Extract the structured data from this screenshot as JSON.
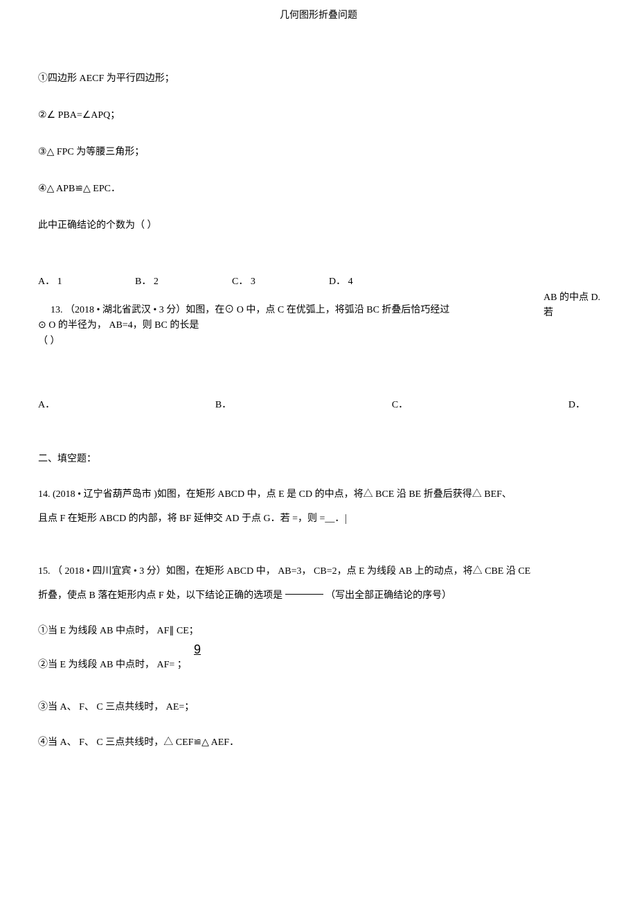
{
  "header": {
    "title": "几何图形折叠问题"
  },
  "body": {
    "p1": "①四边形   AECF 为平行四边形；",
    "p2": "②∠ PBA=∠APQ；",
    "p3": "③△ FPC 为等腰三角形；",
    "p4": "④△ APB≌△ EPC．",
    "p5": "此中正确结论的个数为（             ）",
    "options12": {
      "a": "A． 1",
      "b": "B． 2",
      "c": "C． 3",
      "d": "D． 4"
    },
    "q13": {
      "line1_main": "13. （2018 •  湖北省武汉   • 3 分）如图，在⊙  O 中，点  C 在优弧上，将弧沿      BC 折叠后恰巧经过",
      "line1_right_a": "AB 的中点  D.",
      "line1_right_b": "若",
      "line2": "⊙ O 的半径为，  AB=4，则 BC 的长是",
      "line3": "（                                                          ）",
      "opts": {
        "a": "A．",
        "b": "B．",
        "c": "C．",
        "d": "D．"
      }
    },
    "section2": {
      "heading": "二、填空题："
    },
    "q14": {
      "line1": "14. (2018  • 辽宁省葫芦岛市  )如图，在矩形   ABCD 中，点  E 是  CD 的中点，将△   BCE 沿 BE 折叠后获得△    BEF、",
      "line2": "且点 F 在矩形 ABCD 的内部，将   BF 延伸交  AD 于点 G．若 =，则  =__．"
    },
    "q15": {
      "line1": "15. （ 2018 • 四川宜宾 •  3 分）如图，在矩形   ABCD 中， AB=3， CB=2，点 E 为线段  AB 上的动点，将△    CBE 沿 CE",
      "line2a": "折叠，使点   B 落在矩形内点   F 处，以下结论正确的选项是",
      "line2b": "（写出全部正确结论的序号）",
      "opt1": "①当 E 为线段 AB 中点时， AF∥ CE；",
      "nine": "9",
      "opt2": "②当 E  为线段 AB 中点时， AF=      ；",
      "opt3": "③当 A、 F、 C 三点共线时，  AE=；",
      "opt4": "④当 A、 F、 C 三点共线时，△  CEF≌△ AEF．"
    }
  }
}
